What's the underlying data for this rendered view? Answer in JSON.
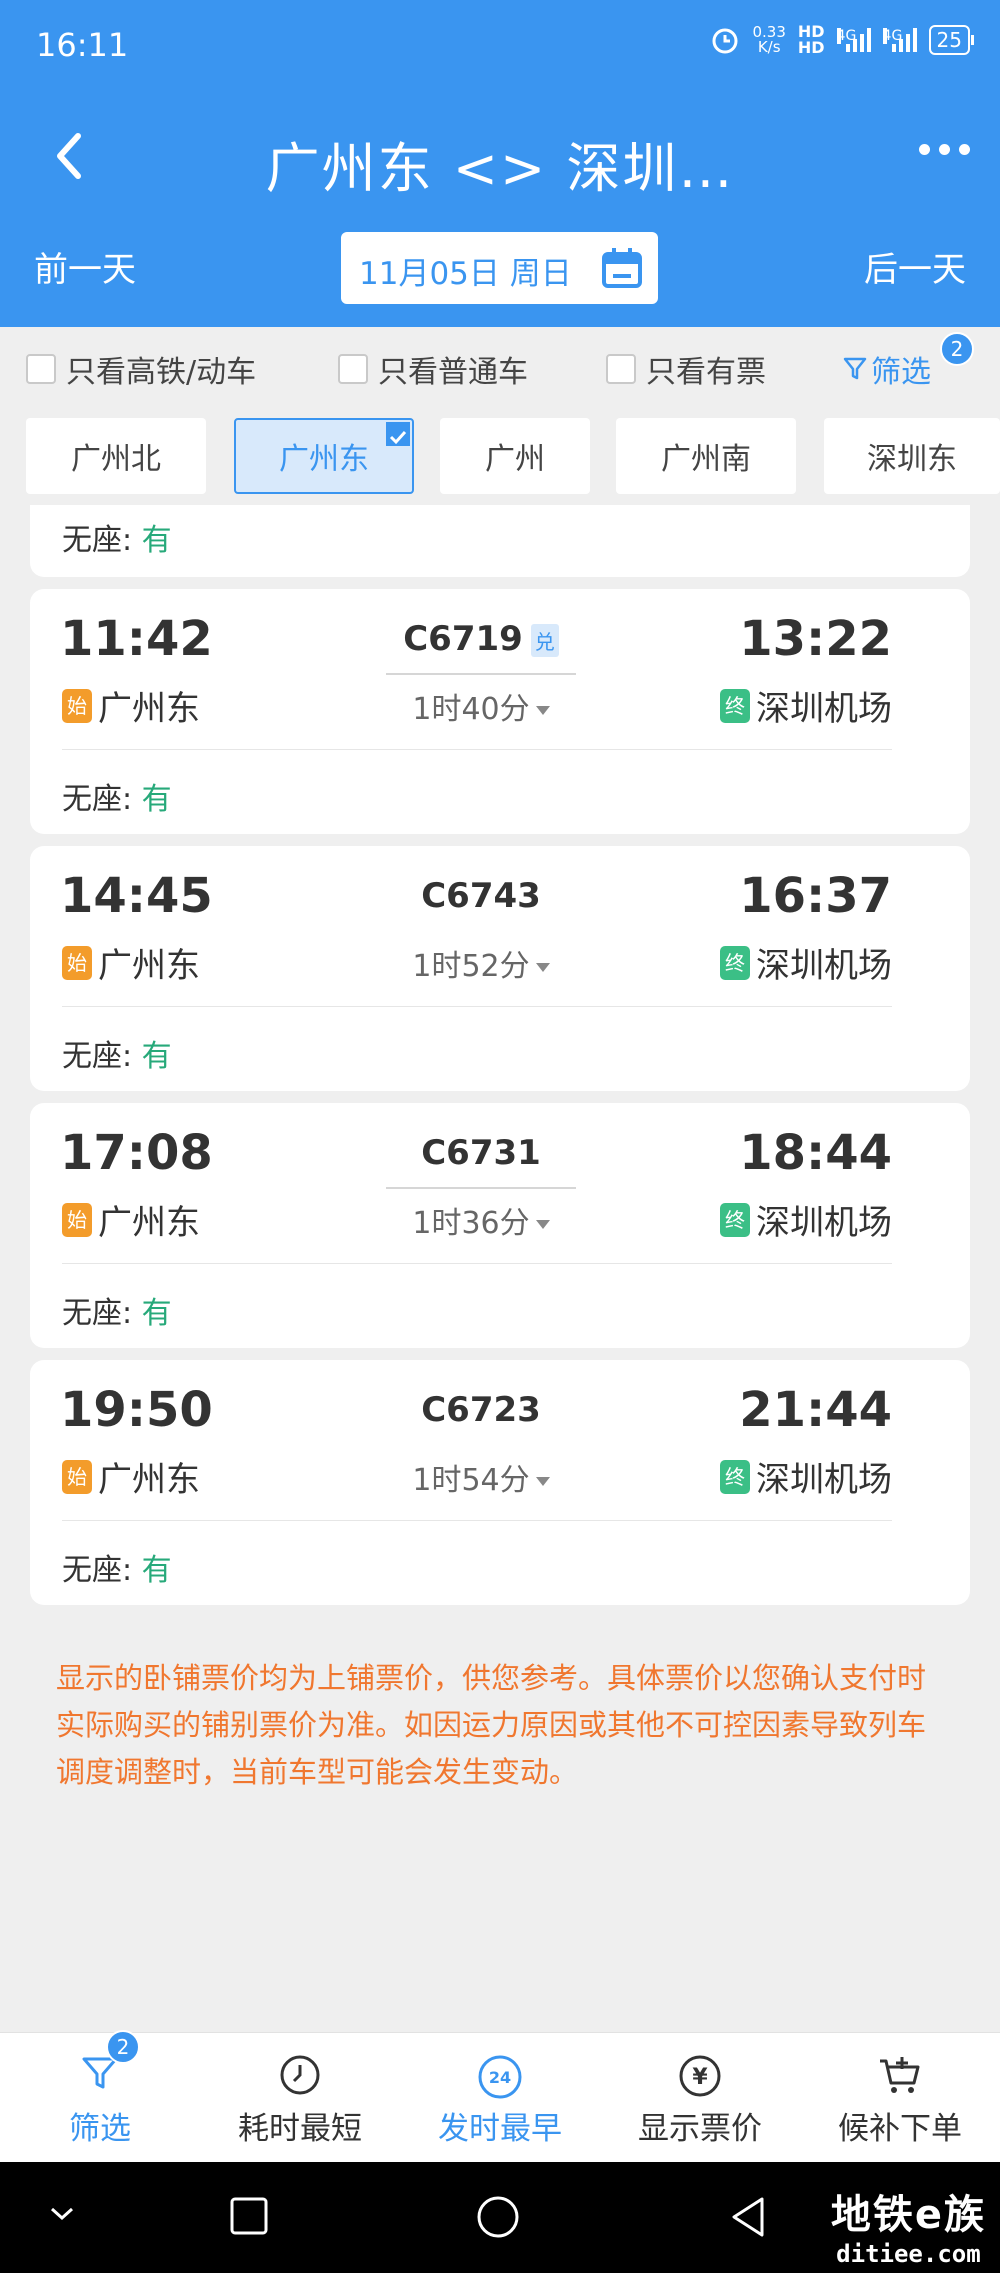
{
  "status_bar": {
    "time": "16:11",
    "net_speed_value": "0.33",
    "net_speed_unit": "K/s",
    "hd1": "HD",
    "hd2": "HD",
    "net1": "4G",
    "net2": "4G",
    "battery": "25"
  },
  "nav": {
    "title": "广州东 <> 深圳…"
  },
  "date_row": {
    "prev": "前一天",
    "date": "11月05日 周日",
    "next": "后一天"
  },
  "filters": {
    "high_speed": "只看高铁/动车",
    "normal": "只看普通车",
    "has_ticket": "只看有票",
    "filter_label": "筛选",
    "filter_count": "2"
  },
  "stations": [
    "广州北",
    "广州东",
    "广州",
    "广州南",
    "深圳东"
  ],
  "partial_card": {
    "seat_label": "无座:",
    "seat_value": "有"
  },
  "trains": [
    {
      "dep_time": "11:42",
      "dep_station": "广州东",
      "dep_tag": "始",
      "train_no": "C6719",
      "extra_tag": "兑",
      "duration": "1时40分",
      "arr_time": "13:22",
      "arr_station": "深圳机场",
      "arr_tag": "终",
      "seat_label": "无座:",
      "seat_value": "有"
    },
    {
      "dep_time": "14:45",
      "dep_station": "广州东",
      "dep_tag": "始",
      "train_no": "C6743",
      "extra_tag": "",
      "duration": "1时52分",
      "arr_time": "16:37",
      "arr_station": "深圳机场",
      "arr_tag": "终",
      "seat_label": "无座:",
      "seat_value": "有"
    },
    {
      "dep_time": "17:08",
      "dep_station": "广州东",
      "dep_tag": "始",
      "train_no": "C6731",
      "extra_tag": "",
      "duration": "1时36分",
      "arr_time": "18:44",
      "arr_station": "深圳机场",
      "arr_tag": "终",
      "seat_label": "无座:",
      "seat_value": "有"
    },
    {
      "dep_time": "19:50",
      "dep_station": "广州东",
      "dep_tag": "始",
      "train_no": "C6723",
      "extra_tag": "",
      "duration": "1时54分",
      "arr_time": "21:44",
      "arr_station": "深圳机场",
      "arr_tag": "终",
      "seat_label": "无座:",
      "seat_value": "有"
    }
  ],
  "notice": "显示的卧铺票价均为上铺票价，供您参考。具体票价以您确认支付时实际购买的铺别票价为准。如因运力原因或其他不可控因素导致列车调度调整时，当前车型可能会发生变动。",
  "toolbar": {
    "filter": "筛选",
    "filter_count": "2",
    "shortest": "耗时最短",
    "earliest": "发时最早",
    "earliest_icon_text": "24",
    "price": "显示票价",
    "price_icon_text": "¥",
    "waitlist": "候补下单"
  },
  "watermark": {
    "title": "地铁e族",
    "url": "ditiee.com"
  },
  "colors": {
    "primary": "#3a95f0",
    "available": "#27a97a",
    "start_tag": "#f39c2b",
    "end_tag": "#3bbf86",
    "notice": "#f0772f"
  }
}
